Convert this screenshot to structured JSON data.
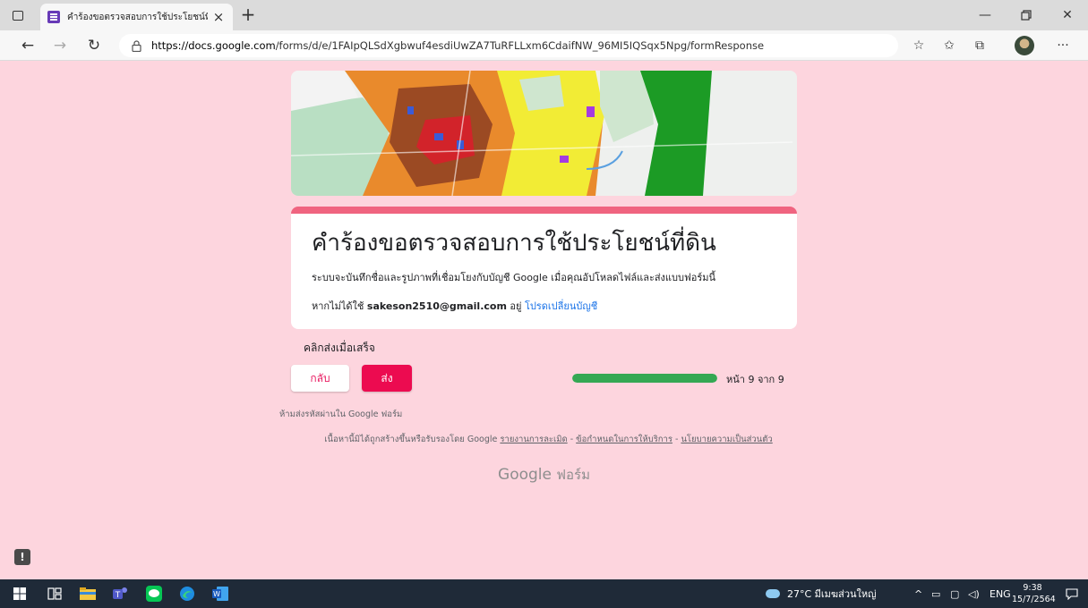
{
  "browser": {
    "tab_title": "คำร้องขอตรวจสอบการใช้ประโยชน์ที่ดิน",
    "url_host": "https://docs.google.com",
    "url_path": "/forms/d/e/1FAIpQLSdXgbwuf4esdiUwZA7TuRFLLxm6CdaifNW_96MI5IQSqx5Npg/formResponse"
  },
  "form": {
    "title": "คำร้องขอตรวจสอบการใช้ประโยชน์ที่ดิน",
    "description": "ระบบจะบันทึกชื่อและรูปภาพที่เชื่อมโยงกับบัญชี Google เมื่อคุณอัปโหลดไฟล์และส่งแบบฟอร์มนี้",
    "account_prefix": "หากไม่ได้ใช้",
    "account_email": "sakeson2510@gmail.com",
    "account_middle": "อยู่",
    "switch_account": "โปรดเปลี่ยนบัญชี",
    "hint": "คลิกส่งเมื่อเสร็จ",
    "back_label": "กลับ",
    "submit_label": "ส่ง",
    "progress_fraction": 1.0,
    "page_count": "หน้า 9 จาก 9",
    "password_warning": "ห้ามส่งรหัสผ่านใน Google ฟอร์ม",
    "footer_prefix": "เนื้อหานี้มิได้ถูกสร้างขึ้นหรือรับรองโดย Google",
    "footer_report": "รายงานการละเมิด",
    "footer_terms": "ข้อกำหนดในการให้บริการ",
    "footer_privacy": "นโยบายความเป็นส่วนตัว",
    "footer_sep": "-",
    "logo_google": "Google",
    "logo_forms": "ฟอร์ม",
    "accent_color": "#f06480",
    "submit_color": "#ec0b50",
    "background_color": "#fdd5de"
  },
  "taskbar": {
    "weather": "27°C มีเมฆส่วนใหญ่",
    "language": "ENG",
    "time": "9:38",
    "date": "15/7/2564"
  }
}
